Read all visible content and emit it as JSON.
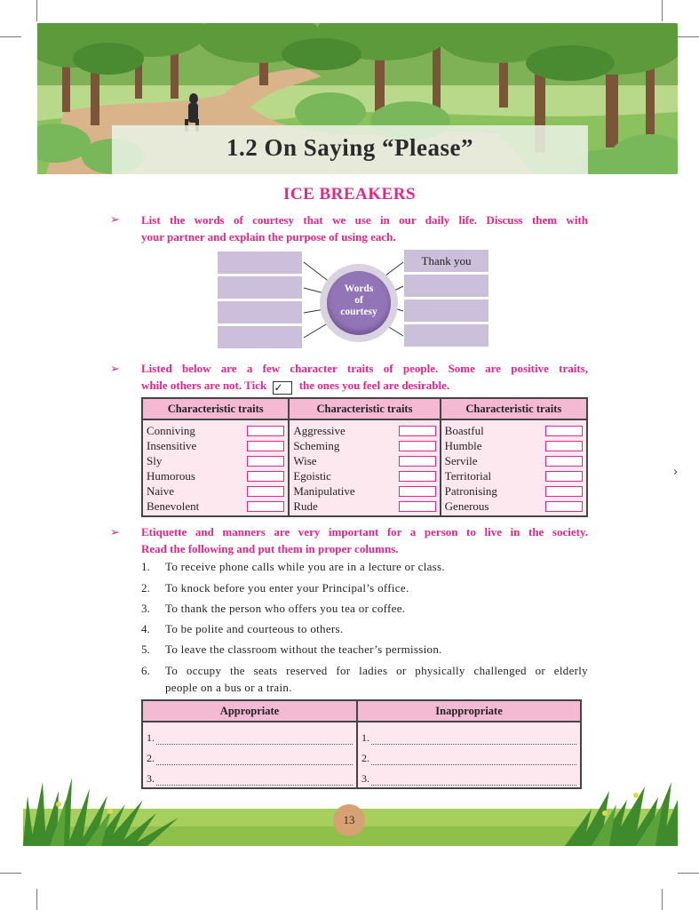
{
  "chapter_title": "1.2 On Saying “Please”",
  "section_heading": "ICE BREAKERS",
  "bullet_symbol": "➢",
  "instruction1": {
    "line1": "List the words of courtesy that we use in our daily life. Discuss them with",
    "line2": "your partner and explain the purpose of using each."
  },
  "diagram": {
    "center_line1": "Words",
    "center_line2": "of",
    "center_line3": "courtesy",
    "right_first_label": "Thank you"
  },
  "instruction2": {
    "line1": "Listed below are a few character traits of people. Some are positive traits,",
    "line2_before": "while others are not. Tick",
    "tick": "✓",
    "line2_after": "the ones you feel are desirable."
  },
  "traits_table": {
    "headers": [
      "Characteristic traits",
      "Characteristic traits",
      "Characteristic traits"
    ],
    "columns": [
      [
        "Conniving",
        "Insensitive",
        "Sly",
        "Humorous",
        "Naive",
        "Benevolent"
      ],
      [
        "Aggressive",
        "Scheming",
        "Wise",
        "Egoistic",
        "Manipulative",
        "Rude"
      ],
      [
        "Boastful",
        "Humble",
        "Servile",
        "Territorial",
        "Patronising",
        "Generous"
      ]
    ]
  },
  "instruction3": {
    "line1": "Etiquette and manners are very important for a person to live in the society.",
    "line2": "Read the following and put them in proper columns."
  },
  "list_items": [
    {
      "num": "1.",
      "text": "To receive phone calls while you are in a lecture or class."
    },
    {
      "num": "2.",
      "text": "To knock before you enter your Principal’s office."
    },
    {
      "num": "3.",
      "text": "To thank the person who offers you tea or coffee."
    },
    {
      "num": "4.",
      "text": "To be polite and courteous to others."
    },
    {
      "num": "5.",
      "text": "To leave the classroom without the teacher’s permission."
    },
    {
      "num": "6.",
      "line1": "To occupy the seats reserved for ladies or physically challenged or elderly",
      "line2": "people on a bus or a train."
    }
  ],
  "manners_table": {
    "headers": [
      "Appropriate",
      "Inappropriate"
    ],
    "row_numbers": [
      "1.",
      "2.",
      "3."
    ]
  },
  "page_number": "13",
  "side_mark": "›"
}
